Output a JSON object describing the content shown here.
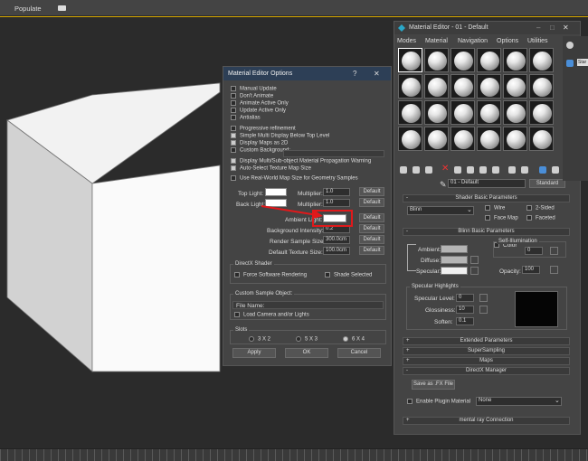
{
  "app_bar": {
    "populate": "Populate"
  },
  "options_dialog": {
    "title": "Material Editor Options",
    "help": "?",
    "close": "✕",
    "checkboxes": [
      {
        "label": "Manual Update",
        "checked": false
      },
      {
        "label": "Don't Animate",
        "checked": false
      },
      {
        "label": "Animate Active Only",
        "checked": false
      },
      {
        "label": "Update Active Only",
        "checked": false
      },
      {
        "label": "Antialias",
        "checked": false
      },
      {
        "label": "Progressive refinement",
        "checked": false
      },
      {
        "label": "Simple Multi Display Below Top Level",
        "checked": true
      },
      {
        "label": "Display Maps as 2D",
        "checked": true
      },
      {
        "label": "Custom Background:",
        "checked": false
      },
      {
        "label": "Display Multi/Sub-object Material Propagation Warning",
        "checked": true
      },
      {
        "label": "Auto-Select Texture Map Size",
        "checked": true
      },
      {
        "label": "Use Real-World Map Size for Geometry Samples",
        "checked": false
      }
    ],
    "top_light": "Top Light:",
    "back_light": "Back Light:",
    "multiplier": "Multiplier:",
    "top_mult": "1.0",
    "back_mult": "1.0",
    "default": "Default",
    "ambient_light": "Ambient Light:",
    "background_intensity": "Background Intensity:",
    "bg_value": "0.2",
    "render_sample_size": "Render Sample Size:",
    "render_value": "300.0cm",
    "default_texture_size": "Default Texture Size:",
    "texture_value": "100.0cm",
    "directx_shader": "DirectX Shader",
    "force_sw": "Force Software Rendering",
    "shade_selected": "Shade Selected",
    "custom_sample": "Custom Sample Object:",
    "file_name": "File Name:",
    "load_camera": "Load Camera and/or Lights",
    "slots": "Slots",
    "slot_3": "3 X 2",
    "slot_5": "5 X 3",
    "slot_6": "6 X 4",
    "apply": "Apply",
    "ok": "OK",
    "cancel": "Cancel"
  },
  "material_editor": {
    "title": "Material Editor - 01 - Default",
    "min": "–",
    "max": "□",
    "close": "✕",
    "menu": [
      "Modes",
      "Material",
      "Navigation",
      "Options",
      "Utilities"
    ],
    "material_name": "01 - Default",
    "material_type": "Standard",
    "shader_params": "Shader Basic Parameters",
    "shader": "Blinn",
    "wire": "Wire",
    "two_sided": "2-Sided",
    "face_map": "Face Map",
    "faceted": "Faceted",
    "blinn_params": "Blinn Basic Parameters",
    "self_illum": "Self-Illumination",
    "color": "Color",
    "color_val": "0",
    "ambient": "Ambient:",
    "diffuse": "Diffuse:",
    "specular": "Specular:",
    "opacity": "Opacity:",
    "opacity_val": "100",
    "spec_highlights": "Specular Highlights",
    "spec_level": "Specular Level:",
    "spec_level_val": "0",
    "glossiness": "Glossiness:",
    "gloss_val": "10",
    "soften": "Soften:",
    "soften_val": "0.1",
    "extended": "Extended Parameters",
    "supersampling": "SuperSampling",
    "maps": "Maps",
    "directx_manager": "DirectX Manager",
    "save_fx": "Save as .FX File",
    "enable_plugin": "Enable Plugin Material",
    "plugin_none": "None",
    "mental_ray": "mental ray Connection"
  },
  "side_panel": {
    "star": "Star"
  },
  "colors": {
    "title_bar": "#2d3f56",
    "annotation": "#e0191b",
    "panel": "#444444",
    "viewport": "#2b2b2b"
  }
}
